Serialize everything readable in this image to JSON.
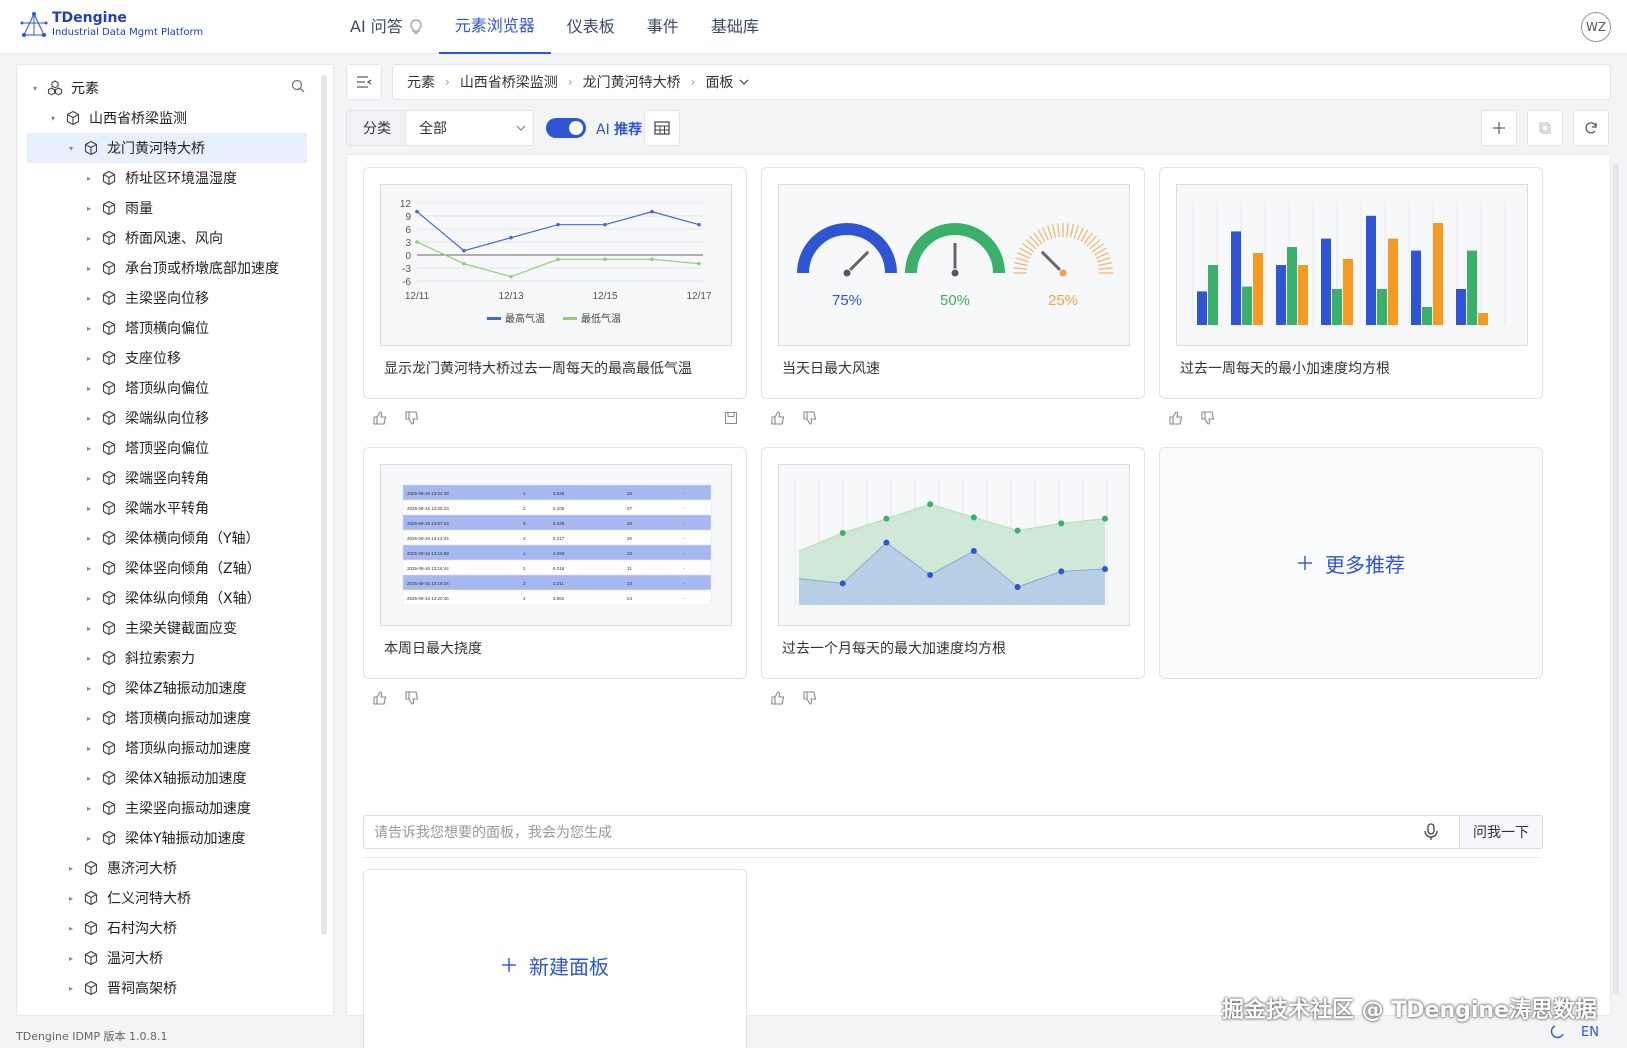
{
  "app": {
    "logo_name": "TDengine",
    "logo_sub": "Industrial Data Mgmt Platform",
    "version": "TDengine IDMP 版本 1.0.8.1",
    "lang": "EN",
    "avatar": "WZ",
    "watermark": "掘金技术社区 @ TDengine涛思数据"
  },
  "nav": [
    {
      "label": "AI 问答",
      "active": false
    },
    {
      "label": "元素浏览器",
      "active": true
    },
    {
      "label": "仪表板",
      "active": false
    },
    {
      "label": "事件",
      "active": false
    },
    {
      "label": "基础库",
      "active": false
    }
  ],
  "tree": {
    "root": "元素",
    "level1": "山西省桥梁监测",
    "selected": "龙门黄河特大桥",
    "children": [
      "桥址区环境温湿度",
      "雨量",
      "桥面风速、风向",
      "承台顶或桥墩底部加速度",
      "主梁竖向位移",
      "塔顶横向偏位",
      "支座位移",
      "塔顶纵向偏位",
      "梁端纵向位移",
      "塔顶竖向偏位",
      "梁端竖向转角",
      "梁端水平转角",
      "梁体横向倾角（Y轴）",
      "梁体竖向倾角（Z轴）",
      "梁体纵向倾角（X轴）",
      "主梁关键截面应变",
      "斜拉索索力",
      "梁体Z轴振动加速度",
      "塔顶横向振动加速度",
      "塔顶纵向振动加速度",
      "梁体X轴振动加速度",
      "主梁竖向振动加速度",
      "梁体Y轴振动加速度"
    ],
    "siblings": [
      "惠济河大桥",
      "仁义河特大桥",
      "石村沟大桥",
      "温河大桥",
      "晋祠高架桥"
    ]
  },
  "breadcrumb": [
    "元素",
    "山西省桥梁监测",
    "龙门黄河特大桥",
    "面板"
  ],
  "toolbar": {
    "filter_label": "分类",
    "filter_value": "全部",
    "ai_prefix": "AI",
    "ai_suffix": "推荐"
  },
  "cards": [
    {
      "caption": "显示龙门黄河特大桥过去一周每天的最高最低气温"
    },
    {
      "caption": "当天日最大风速"
    },
    {
      "caption": "过去一周每天的最小加速度均方根"
    },
    {
      "caption": "本周日最大挠度"
    },
    {
      "caption": "过去一个月每天的最大加速度均方根"
    }
  ],
  "more_label": "更多推荐",
  "new_panel_label": "新建面板",
  "ask": {
    "placeholder": "请告诉我您想要的面板，我会为您生成",
    "button": "问我一下"
  },
  "mini_line": {
    "yticks": [
      "12",
      "9",
      "6",
      "3",
      "0",
      "-3",
      "-6"
    ],
    "xticks": [
      "12/11",
      "12/13",
      "12/15",
      "12/17"
    ],
    "legend": [
      "最高气温",
      "最低气温"
    ],
    "high": [
      10,
      1,
      4,
      7,
      7,
      10,
      7
    ],
    "low": [
      3,
      -2,
      -5,
      -1,
      -1,
      -1,
      -2
    ]
  },
  "gauges": [
    {
      "label": "75%",
      "value": 0.75,
      "color": "#2f55d4"
    },
    {
      "label": "50%",
      "value": 0.5,
      "color": "#3ab06a"
    },
    {
      "label": "25%",
      "value": 0.25,
      "color": "#f0a24a"
    }
  ],
  "mini_bar": {
    "groups": [
      [
        0.28,
        0.5
      ],
      [
        0.78,
        0.32,
        0.6
      ],
      [
        0.5,
        0.65,
        0.5
      ],
      [
        0.72,
        0.3,
        0.55
      ],
      [
        0.91,
        0.3,
        0.72
      ],
      [
        0.62,
        0.15,
        0.85
      ],
      [
        0.3,
        0.62,
        0.1
      ]
    ],
    "colors": [
      "#2f55d4",
      "#3ab06a",
      "#f59a23"
    ]
  },
  "mini_table": {
    "rows": [
      [
        "2025-09-16 13:02:48",
        "1",
        "3.045",
        "25",
        "-"
      ],
      [
        "2025-09-16 13:05:23",
        "2",
        "2.105",
        "27",
        "-"
      ],
      [
        "2025-09-16 13:07:13",
        "3",
        "6.239",
        "26",
        "-"
      ],
      [
        "2025-09-16 13:12:34",
        "2",
        "5.217",
        "25",
        "-"
      ],
      [
        "2025-09-16 13:15:58",
        "1",
        "4.293",
        "23",
        "-"
      ],
      [
        "2025-09-16 13:16:44",
        "2",
        "6.316",
        "21",
        "-"
      ],
      [
        "2025-09-16 13:18:34",
        "3",
        "3.211",
        "23",
        "-"
      ],
      [
        "2025-09-16 13:20:46",
        "4",
        "3.961",
        "24",
        "-"
      ]
    ]
  },
  "mini_area": {
    "green": [
      0.45,
      0.6,
      0.72,
      0.84,
      0.73,
      0.62,
      0.68,
      0.72
    ],
    "blue": [
      0.22,
      0.18,
      0.52,
      0.25,
      0.45,
      0.15,
      0.28,
      0.3
    ]
  }
}
